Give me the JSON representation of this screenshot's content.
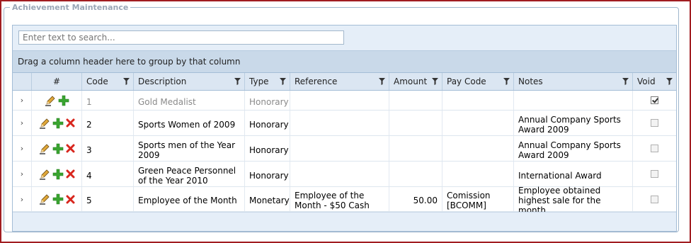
{
  "panel": {
    "title": "Achievement Maintenance"
  },
  "search": {
    "placeholder": "Enter text to search..."
  },
  "group_panel": {
    "text": "Drag a column header here to group by that column"
  },
  "columns": {
    "index": "#",
    "code": "Code",
    "description": "Description",
    "type": "Type",
    "reference": "Reference",
    "amount": "Amount",
    "pay_code": "Pay Code",
    "notes": "Notes",
    "void": "Void"
  },
  "rows": [
    {
      "code": "1",
      "description": "Gold Medalist",
      "type": "Honorary",
      "reference": "",
      "amount": "",
      "pay_code": "",
      "notes": "",
      "void": true,
      "deletable": false
    },
    {
      "code": "2",
      "description": "Sports Women of 2009",
      "type": "Honorary",
      "reference": "",
      "amount": "",
      "pay_code": "",
      "notes": "Annual Company Sports Award 2009",
      "void": false,
      "deletable": true
    },
    {
      "code": "3",
      "description": "Sports men of the Year 2009",
      "type": "Honorary",
      "reference": "",
      "amount": "",
      "pay_code": "",
      "notes": "Annual Company Sports Award 2009",
      "void": false,
      "deletable": true
    },
    {
      "code": "4",
      "description": "Green Peace Personnel of the Year 2010",
      "type": "Honorary",
      "reference": "",
      "amount": "",
      "pay_code": "",
      "notes": "International Award",
      "void": false,
      "deletable": true
    },
    {
      "code": "5",
      "description": "Employee of the Month",
      "type": "Monetary",
      "reference": "Employee of the Month - $50 Cash",
      "amount": "50.00",
      "pay_code": "Comission [BCOMM]",
      "notes": "Employee obtained highest sale for the month.",
      "void": false,
      "deletable": true
    }
  ],
  "icons": {
    "expand": "chevron-right-icon",
    "edit": "pencil-icon",
    "add": "plus-icon",
    "delete": "close-icon",
    "filter": "filter-icon"
  },
  "colors": {
    "frame_border": "#a11d21",
    "header_bg": "#dbe6f2",
    "group_panel_bg": "#c9d9e9",
    "add_green": "#3aa530",
    "delete_red": "#d8261d"
  }
}
